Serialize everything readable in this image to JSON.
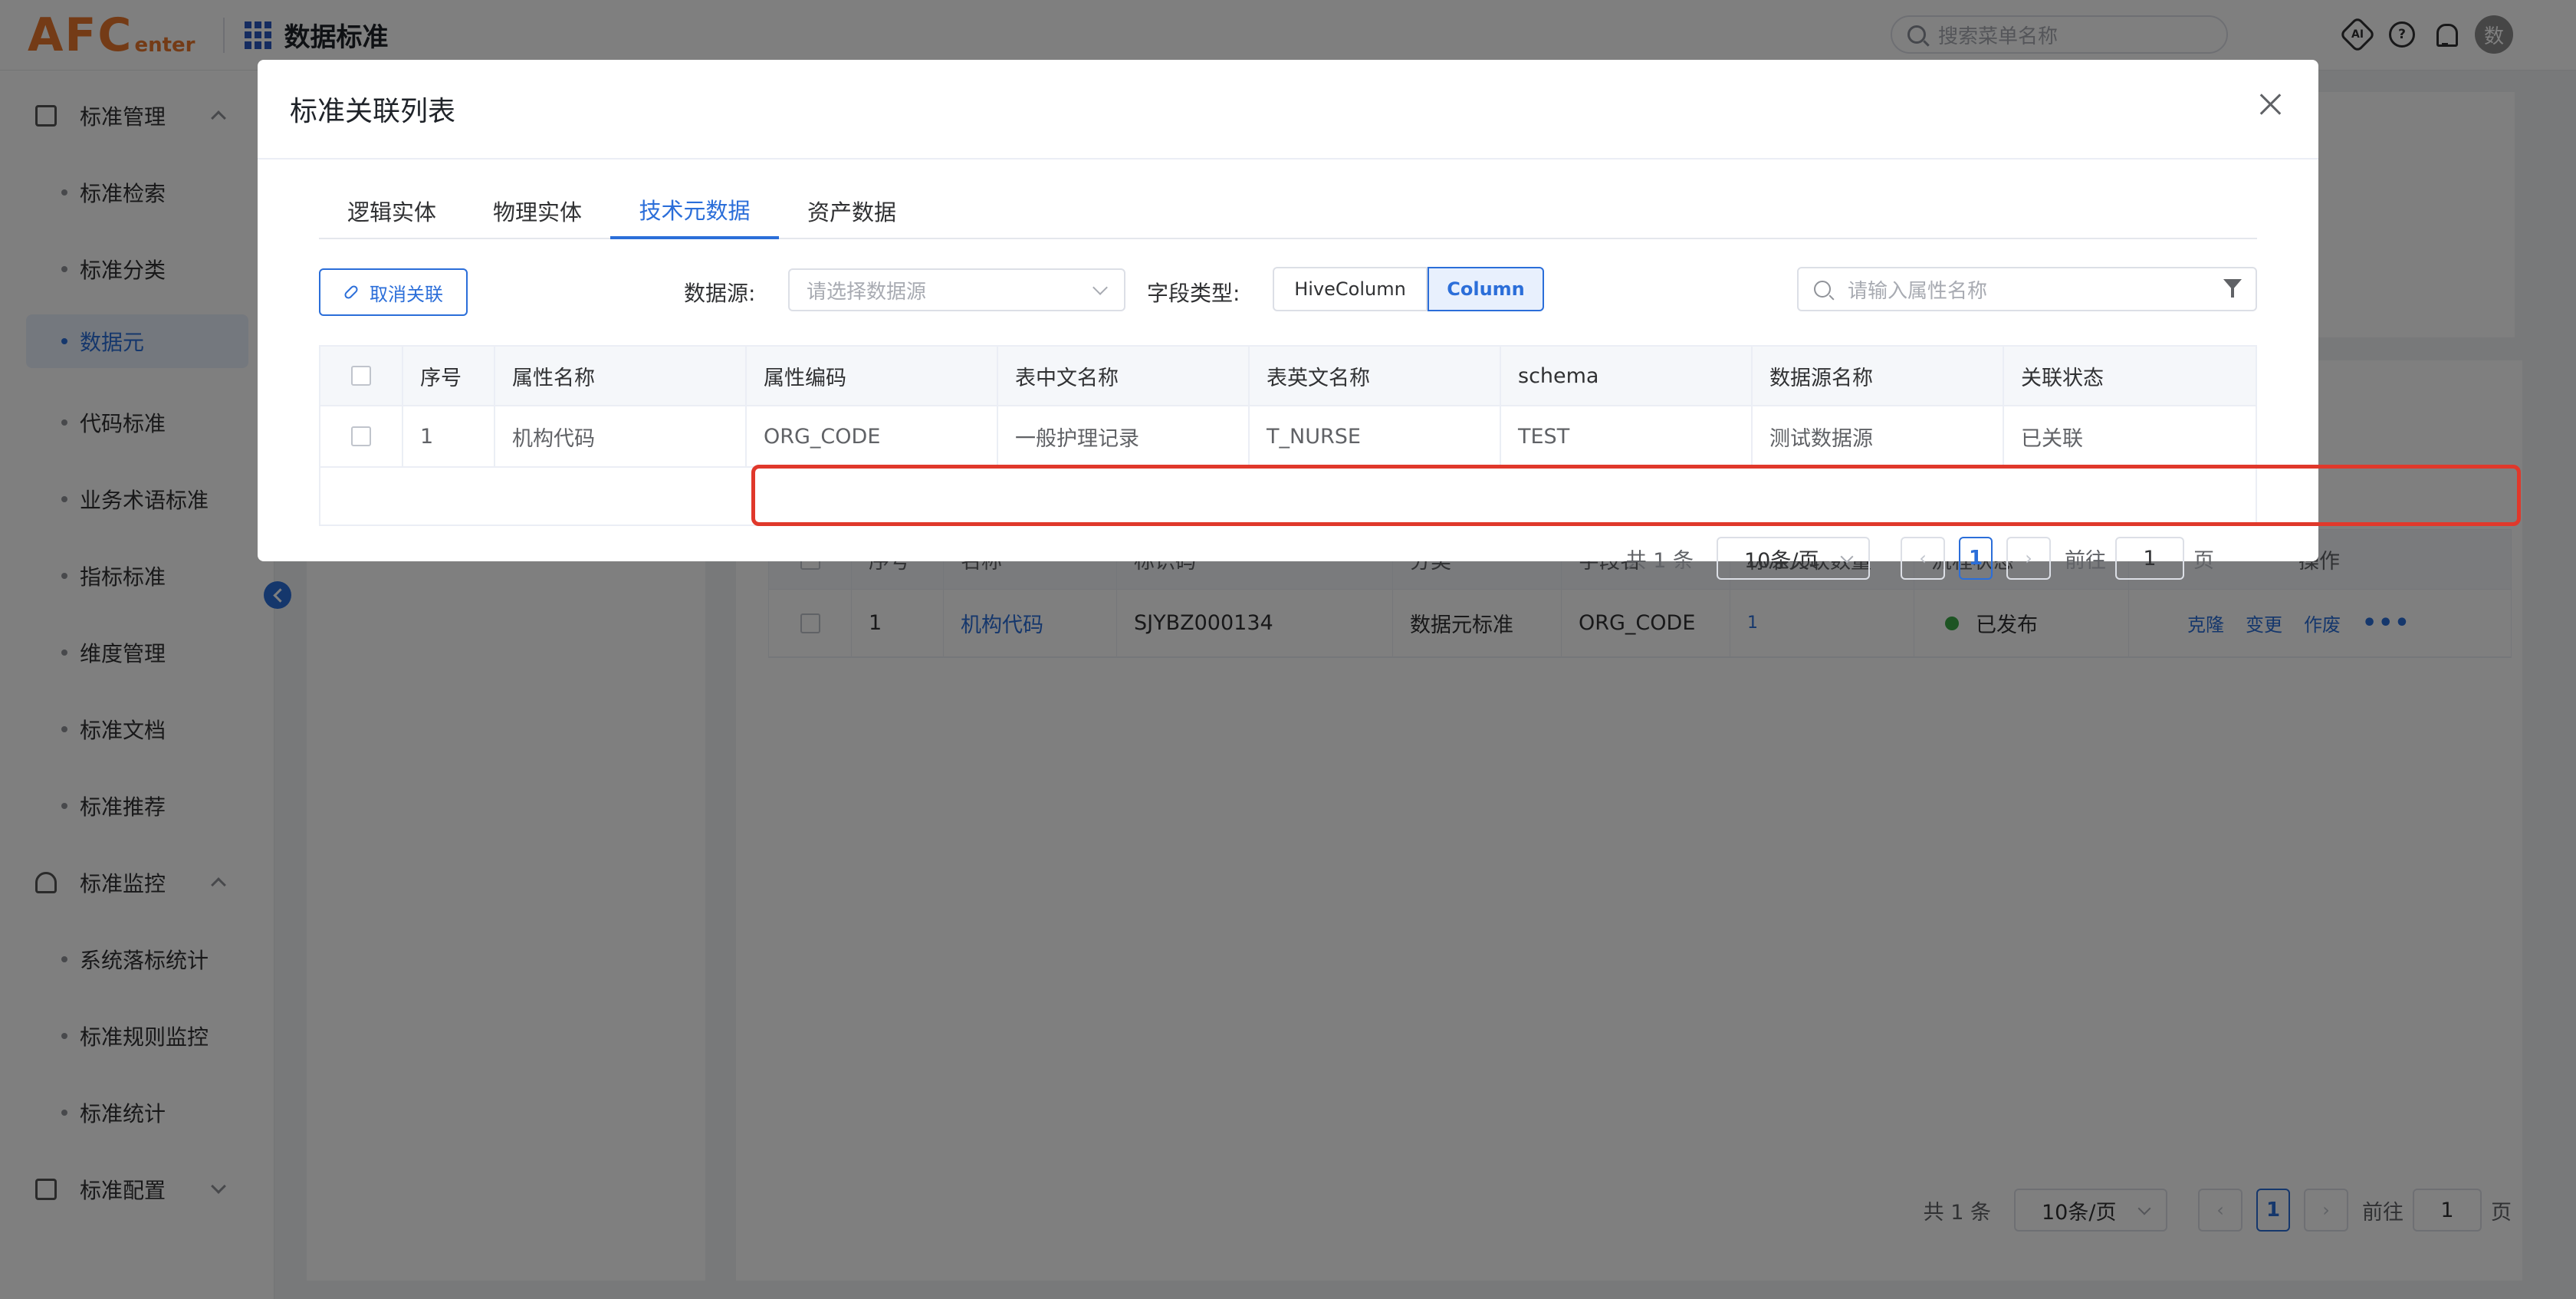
{
  "header": {
    "logo_main": "AFC",
    "logo_sub": "enter",
    "app_title": "数据标准",
    "search_placeholder": "搜索菜单名称",
    "ai_label": "AI",
    "help_label": "?",
    "avatar_text": "数"
  },
  "sidebar": {
    "group1": "标准管理",
    "items1": [
      "标准检索",
      "标准分类",
      "数据元",
      "代码标准",
      "业务术语标准",
      "指标标准",
      "维度管理",
      "标准文档",
      "标准推荐"
    ],
    "group2": "标准监控",
    "items2": [
      "系统落标统计",
      "标准规则监控",
      "标准统计"
    ],
    "group3": "标准配置",
    "active_item": "数据元"
  },
  "background_table": {
    "headers": [
      "",
      "序号",
      "名称",
      "标识码",
      "分类",
      "字段名",
      "标准关联数量",
      "流程状态",
      "操作"
    ],
    "row": {
      "index": "1",
      "name": "机构代码",
      "code": "SJYBZ000134",
      "category": "数据元标准",
      "field": "ORG_CODE",
      "link_count": "1",
      "status": "已发布",
      "actions": [
        "克隆",
        "变更",
        "作废"
      ],
      "more": "•••"
    },
    "pager": {
      "total": "共 1 条",
      "page_size": "10条/页",
      "current_page": "1",
      "goto_label": "前往",
      "goto_value": "1",
      "page_suffix": "页"
    }
  },
  "modal": {
    "title": "标准关联列表",
    "tabs": [
      "逻辑实体",
      "物理实体",
      "技术元数据",
      "资产数据"
    ],
    "active_tab": "技术元数据",
    "unlink_button": "取消关联",
    "datasource_label": "数据源:",
    "datasource_placeholder": "请选择数据源",
    "field_type_label": "字段类型:",
    "field_type_options": [
      "HiveColumn",
      "Column"
    ],
    "field_type_selected": "Column",
    "search_placeholder": "请输入属性名称",
    "table": {
      "headers": [
        "",
        "序号",
        "属性名称",
        "属性编码",
        "表中文名称",
        "表英文名称",
        "schema",
        "数据源名称",
        "关联状态"
      ],
      "rows": [
        {
          "index": "1",
          "attr_name": "机构代码",
          "attr_code": "ORG_CODE",
          "table_cn": "一般护理记录",
          "table_en": "T_NURSE",
          "schema": "TEST",
          "datasource": "测试数据源",
          "status": "已关联"
        }
      ]
    },
    "pager": {
      "total": "共 1 条",
      "page_size": "10条/页",
      "current_page": "1",
      "goto_label": "前往",
      "goto_value": "1",
      "page_suffix": "页"
    }
  }
}
